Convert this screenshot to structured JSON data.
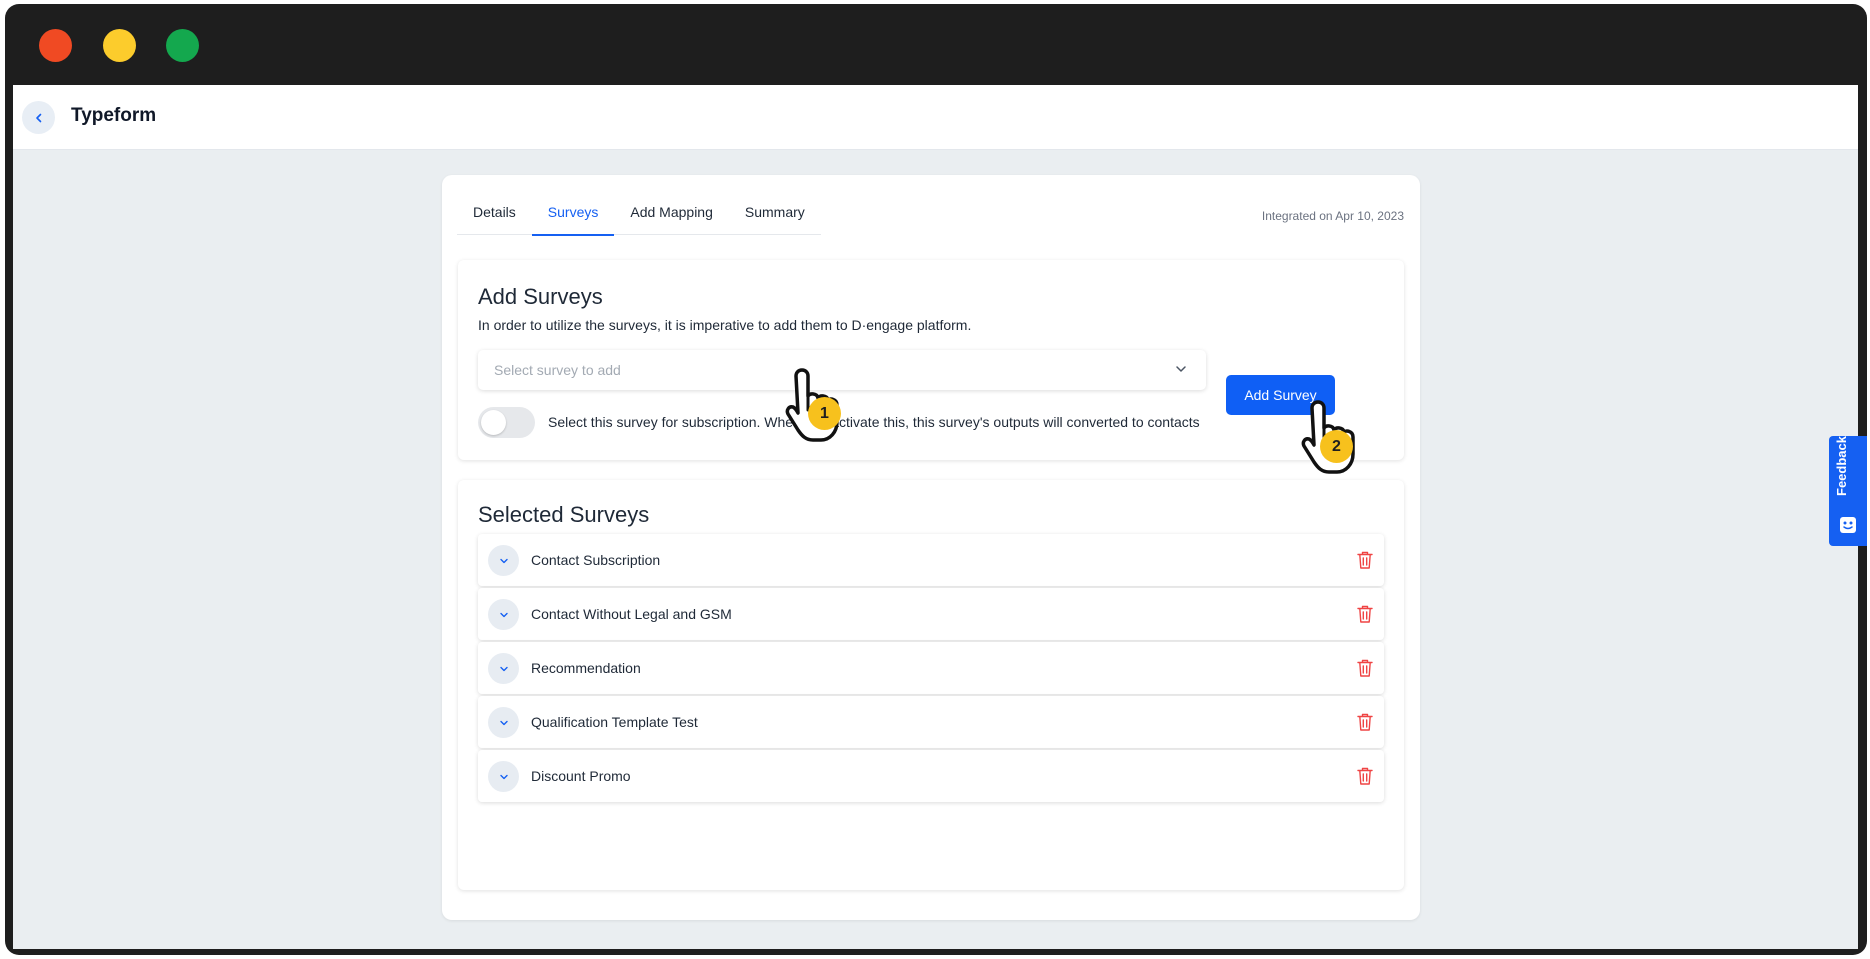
{
  "window": {
    "title": "Typeform"
  },
  "tabs": [
    {
      "label": "Details",
      "active": false
    },
    {
      "label": "Surveys",
      "active": true
    },
    {
      "label": "Add Mapping",
      "active": false
    },
    {
      "label": "Summary",
      "active": false
    }
  ],
  "integrated_text": "Integrated on Apr 10, 2023",
  "add_surveys": {
    "title": "Add Surveys",
    "description": "In order to utilize the surveys, it is imperative to add them to D·engage platform.",
    "select_placeholder": "Select survey to add",
    "add_button_label": "Add Survey",
    "toggle_on": false,
    "toggle_label": "Select this survey for subscription. When you activate this, this survey's outputs will converted to contacts"
  },
  "selected_surveys": {
    "title": "Selected Surveys",
    "items": [
      {
        "label": "Contact Subscription"
      },
      {
        "label": "Contact Without Legal and GSM"
      },
      {
        "label": "Recommendation"
      },
      {
        "label": "Qualification Template Test"
      },
      {
        "label": "Discount Promo"
      }
    ]
  },
  "feedback_label": "Feedback",
  "step_badges": [
    "1",
    "2"
  ],
  "colors": {
    "accent": "#1560f2",
    "button": "#0f5ff5",
    "danger": "#ef4444",
    "badge": "#f7c11d"
  },
  "icons": {
    "back": "chevron-left-icon",
    "select": "chevron-down-icon",
    "expand": "chevron-down-icon",
    "delete": "trash-icon",
    "feedback": "feedback-icon",
    "cursor": "hand-pointer-icon"
  }
}
